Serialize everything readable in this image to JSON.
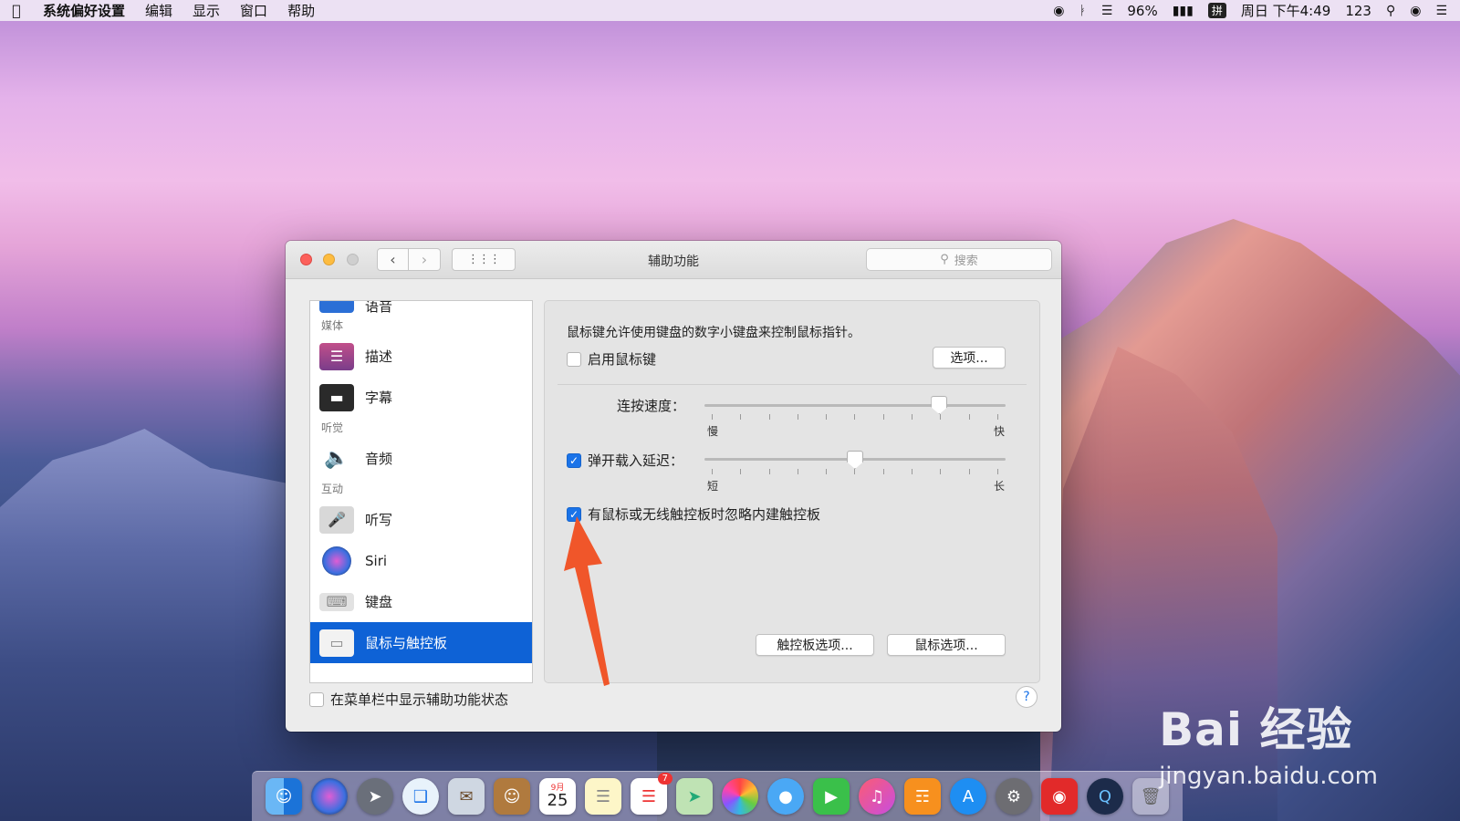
{
  "menubar": {
    "app_name": "系统偏好设置",
    "items": [
      "编辑",
      "显示",
      "窗口",
      "帮助"
    ],
    "battery": "96%",
    "ime": "拼",
    "clock": "周日 下午4:49",
    "input_label": "123"
  },
  "window": {
    "title": "辅助功能",
    "search_placeholder": "搜索"
  },
  "sidebar": {
    "partial_item": "语音",
    "sections": {
      "media": "媒体",
      "hearing": "听觉",
      "interaction": "互动"
    },
    "items": {
      "describe": "描述",
      "captions": "字幕",
      "audio": "音频",
      "dictation": "听写",
      "siri": "Siri",
      "keyboard": "键盘",
      "mouse": "鼠标与触控板"
    }
  },
  "panel": {
    "description": "鼠标键允许使用键盘的数字小键盘来控制鼠标指针。",
    "enable_mouse_keys": "启用鼠标键",
    "options_button": "选项...",
    "repeat_speed_label": "连按速度：",
    "repeat_speed_min": "慢",
    "repeat_speed_max": "快",
    "repeat_speed_value": 0.78,
    "spring_delay_label": "弹开载入延迟：",
    "spring_delay_min": "短",
    "spring_delay_max": "长",
    "spring_delay_value": 0.5,
    "ignore_trackpad": "有鼠标或无线触控板时忽略内建触控板",
    "trackpad_options": "触控板选项...",
    "mouse_options": "鼠标选项..."
  },
  "footer": {
    "show_status": "在菜单栏中显示辅助功能状态",
    "help": "?"
  },
  "dock": {
    "calendar_month": "9月",
    "calendar_day": "25",
    "reminders_badge": "7"
  },
  "watermark": {
    "brand": "Bai  经验",
    "url": "jingyan.baidu.com"
  },
  "colors": {
    "accent": "#1a73e8",
    "selection": "#0e62d6",
    "annotation_arrow": "#f0562a"
  }
}
